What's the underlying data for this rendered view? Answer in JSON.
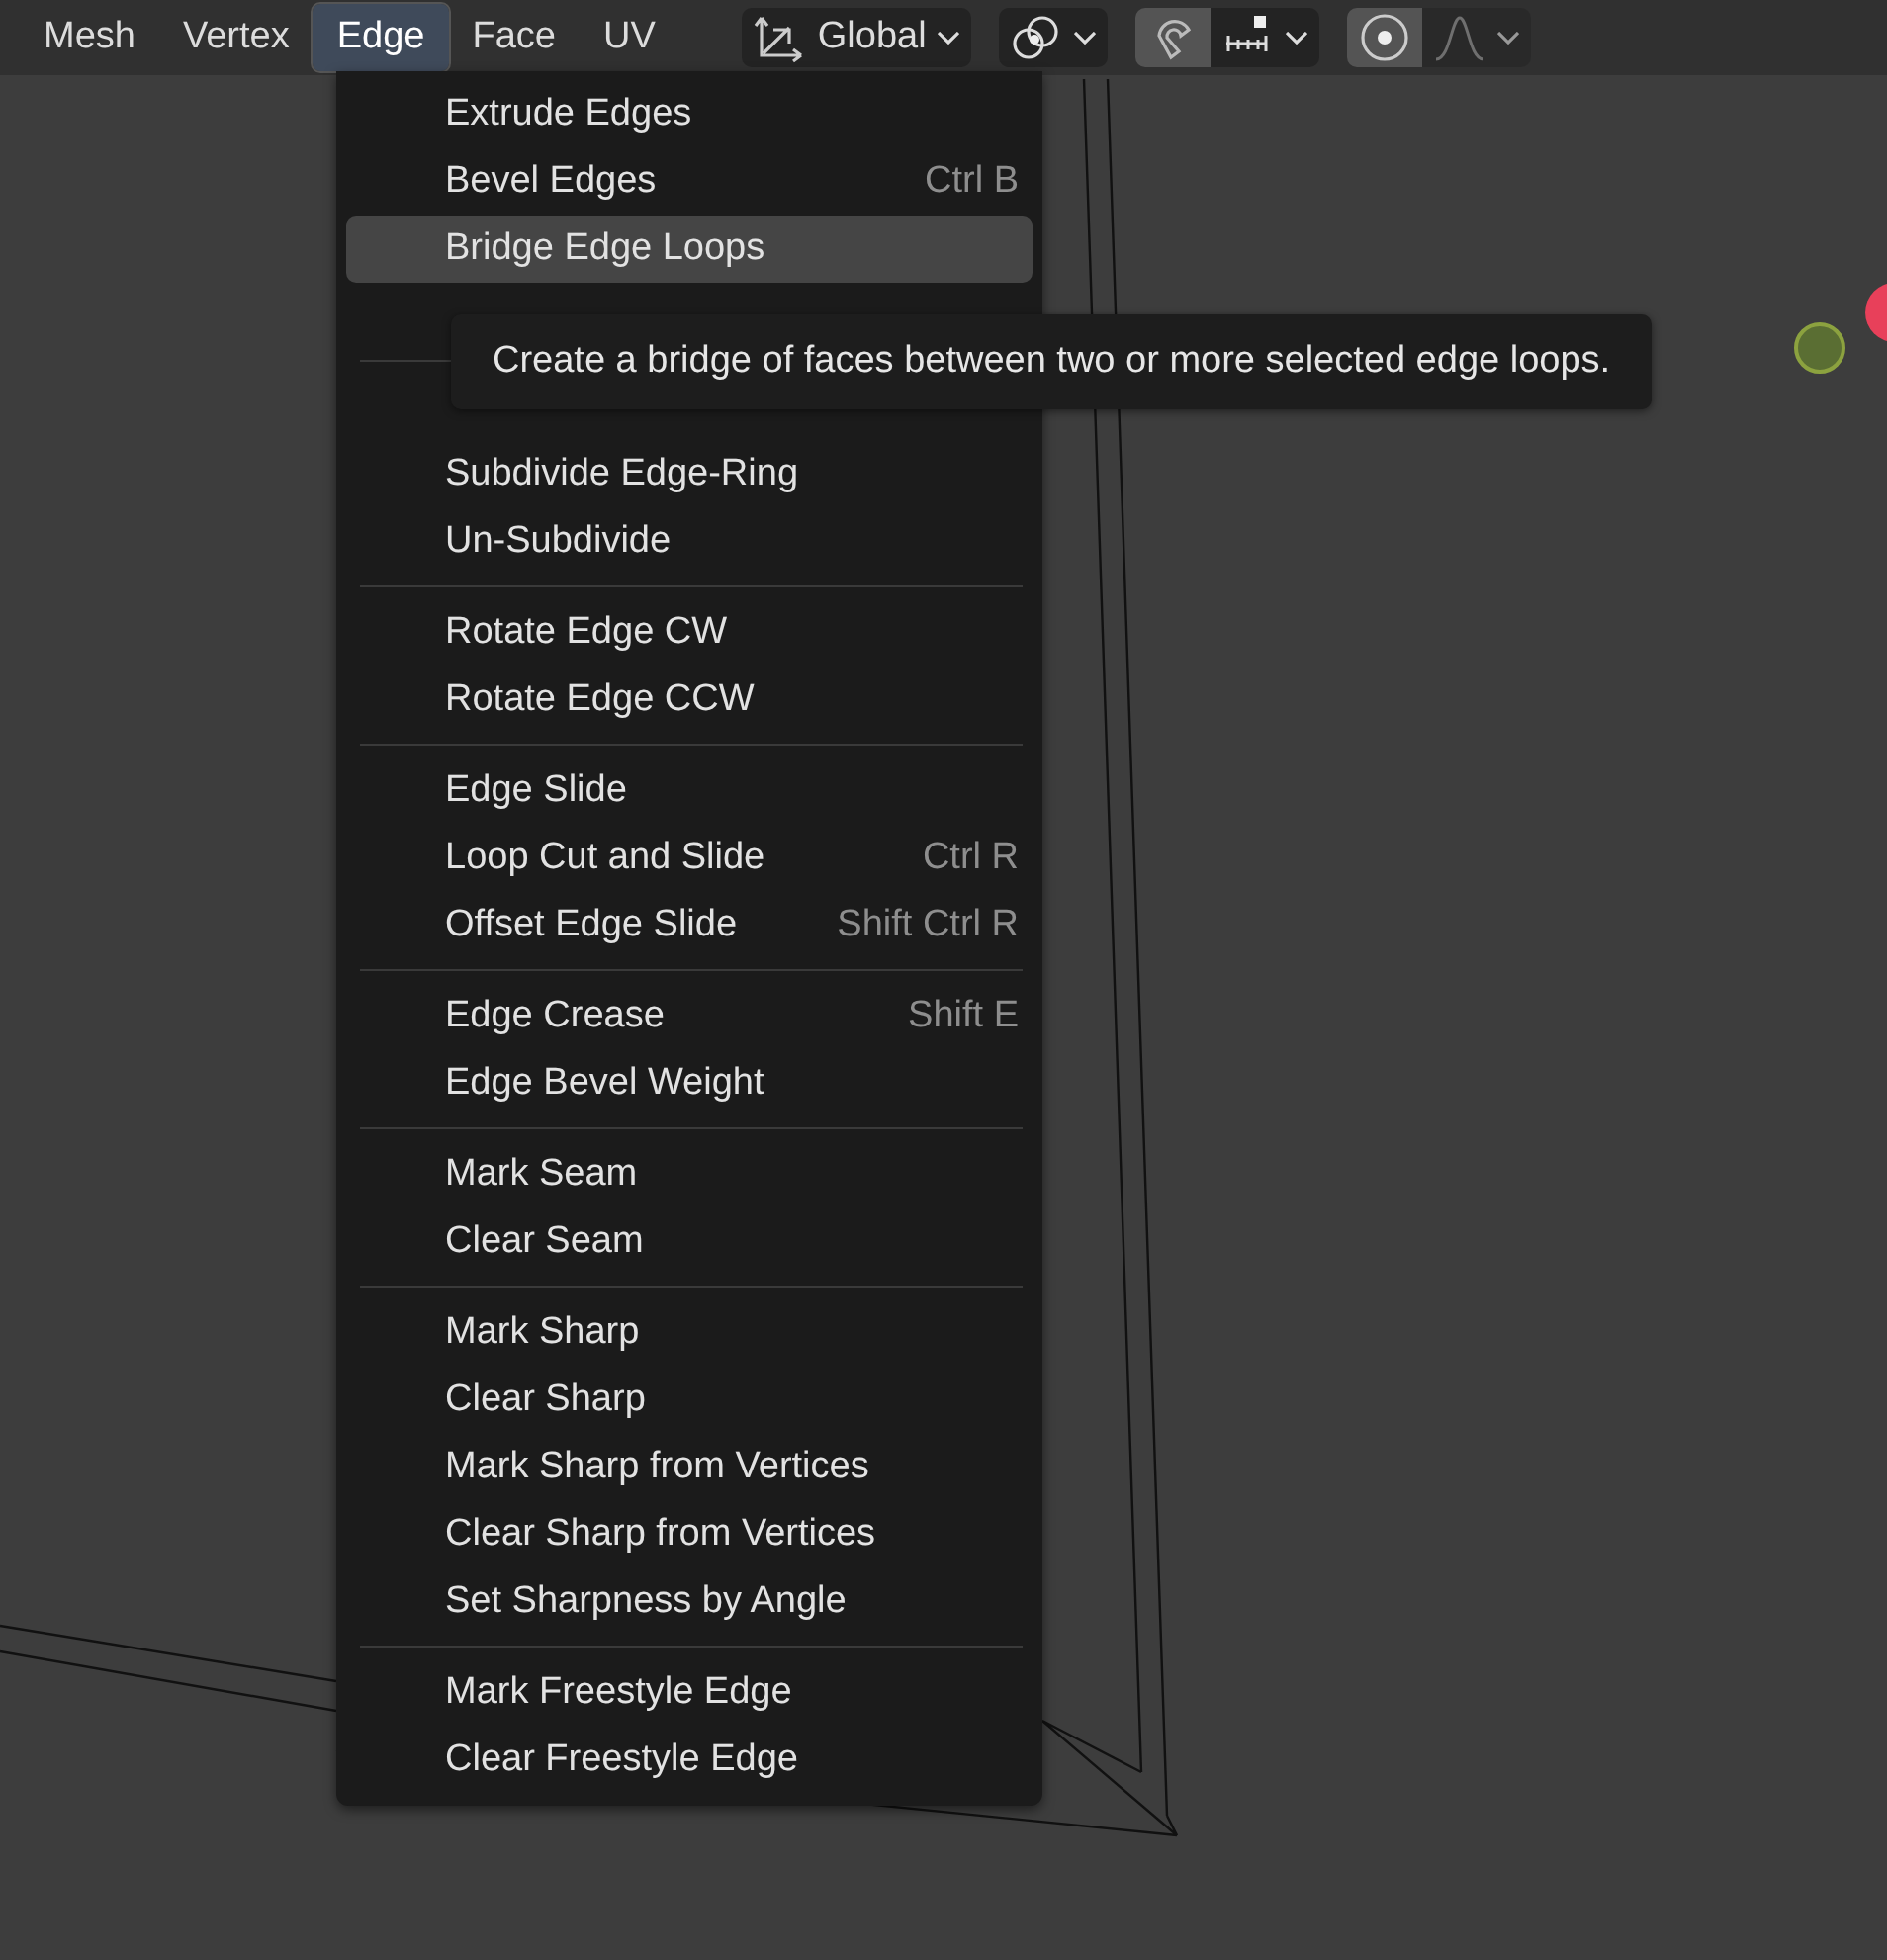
{
  "menubar": [
    {
      "label": "Mesh",
      "selected": false
    },
    {
      "label": "Vertex",
      "selected": false
    },
    {
      "label": "Edge",
      "selected": true
    },
    {
      "label": "Face",
      "selected": false
    },
    {
      "label": "UV",
      "selected": false
    }
  ],
  "toolbar": [
    {
      "kind": "orientation",
      "label": "Global",
      "on": false
    },
    {
      "kind": "pivot",
      "on": false
    },
    {
      "kind": "snap",
      "on": true
    },
    {
      "kind": "increment",
      "on": false
    },
    {
      "kind": "proportional",
      "on": true
    },
    {
      "kind": "falloff",
      "on": false
    }
  ],
  "menu": {
    "sections": [
      {
        "items": [
          {
            "label": "Extrude Edges",
            "selected": false
          },
          {
            "label": "Bevel Edges",
            "shortcut": "Ctrl B",
            "selected": false
          },
          {
            "label": "Bridge Edge Loops",
            "selected": true
          },
          {
            "kind": "covered"
          }
        ]
      },
      {
        "items": [
          {
            "kind": "covered"
          },
          {
            "label": "Subdivide Edge-Ring",
            "selected": false
          },
          {
            "label": "Un-Subdivide",
            "selected": false
          }
        ]
      },
      {
        "items": [
          {
            "label": "Rotate Edge CW",
            "selected": false
          },
          {
            "label": "Rotate Edge CCW",
            "selected": false
          }
        ]
      },
      {
        "items": [
          {
            "label": "Edge Slide",
            "selected": false
          },
          {
            "label": "Loop Cut and Slide",
            "shortcut": "Ctrl R",
            "selected": false
          },
          {
            "label": "Offset Edge Slide",
            "shortcut": "Shift Ctrl R",
            "selected": false
          }
        ]
      },
      {
        "items": [
          {
            "label": "Edge Crease",
            "shortcut": "Shift E",
            "selected": false
          },
          {
            "label": "Edge Bevel Weight",
            "selected": false
          }
        ]
      },
      {
        "items": [
          {
            "label": "Mark Seam",
            "selected": false
          },
          {
            "label": "Clear Seam",
            "selected": false
          }
        ]
      },
      {
        "items": [
          {
            "label": "Mark Sharp",
            "selected": false
          },
          {
            "label": "Clear Sharp",
            "selected": false
          },
          {
            "label": "Mark Sharp from Vertices",
            "selected": false
          },
          {
            "label": "Clear Sharp from Vertices",
            "selected": false
          },
          {
            "label": "Set Sharpness by Angle",
            "selected": false
          }
        ]
      },
      {
        "items": [
          {
            "label": "Mark Freestyle Edge",
            "selected": false
          },
          {
            "label": "Clear Freestyle Edge",
            "selected": false
          }
        ]
      }
    ]
  },
  "tooltip": {
    "text": "Create a bridge of faces between two or more selected edge loops."
  }
}
